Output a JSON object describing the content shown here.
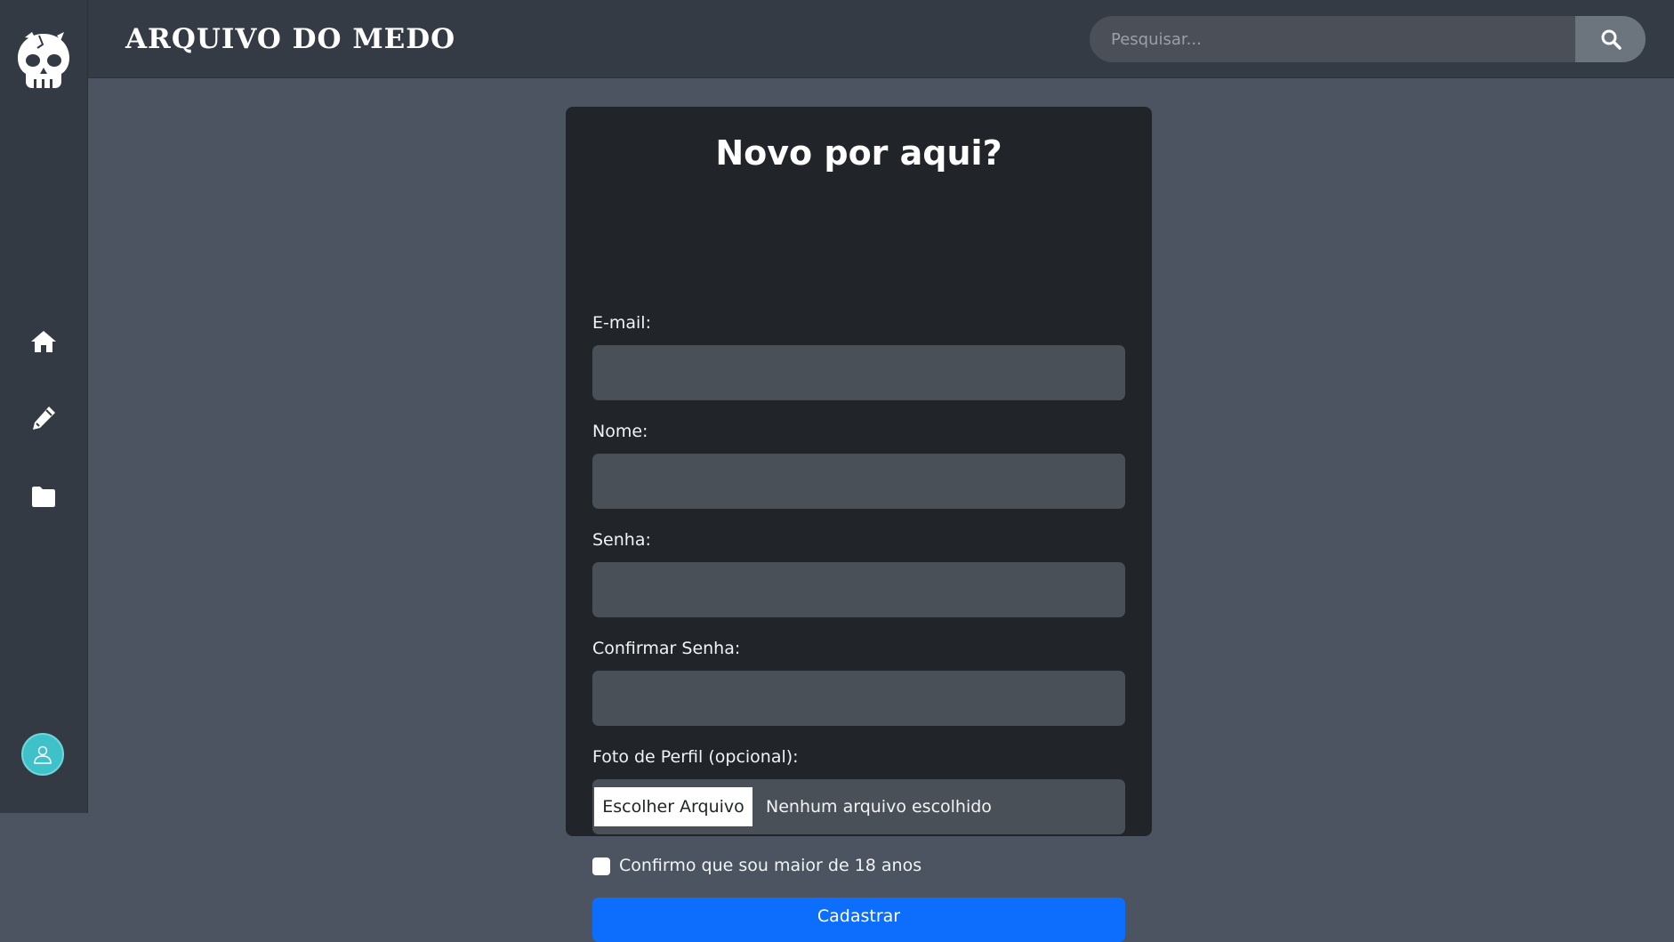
{
  "app": {
    "brand": "ARQUIVO DO MEDO"
  },
  "search": {
    "placeholder": "Pesquisar..."
  },
  "sidebar": {
    "items": [
      {
        "icon": "home-icon"
      },
      {
        "icon": "pencil-icon"
      },
      {
        "icon": "folder-icon"
      }
    ],
    "avatar_icon": "user-icon"
  },
  "form": {
    "title": "Novo por aqui?",
    "email_label": "E-mail:",
    "name_label": "Nome:",
    "password_label": "Senha:",
    "confirm_label": "Confirmar Senha:",
    "photo_label": "Foto de Perfil (opcional):",
    "file_button": "Escolher Arquivo",
    "file_status": "Nenhum arquivo escolhido",
    "age_confirm": "Confirmo que sou maior de 18 anos",
    "submit": "Cadastrar"
  },
  "colors": {
    "background": "#4b5460",
    "sidebar": "#343a43",
    "card": "#212529",
    "input": "#495057",
    "primary": "#0d6efd",
    "avatar": "#3ec1c9"
  }
}
